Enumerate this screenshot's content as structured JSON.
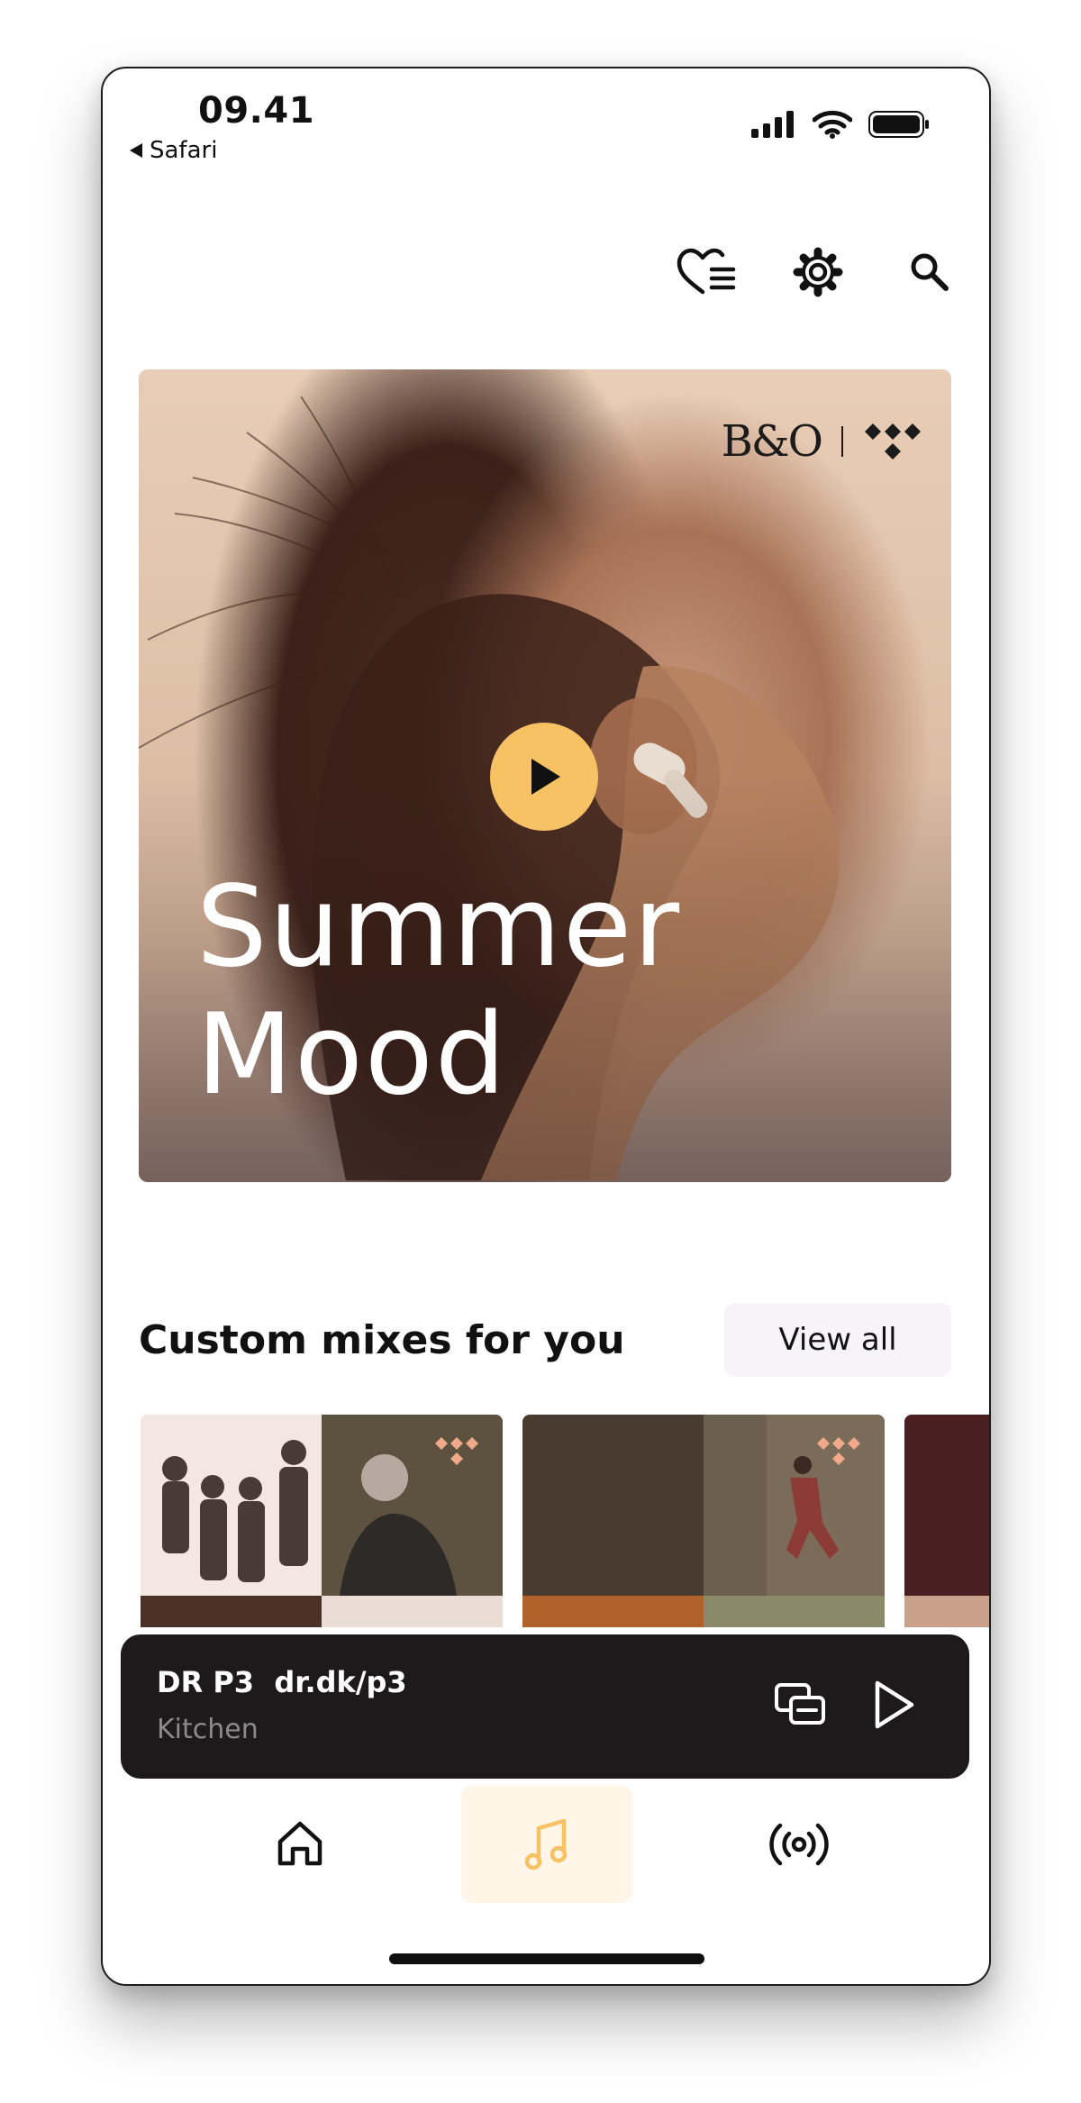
{
  "status_bar": {
    "time": "09.41",
    "back_app": "Safari"
  },
  "top_actions": {
    "icons": [
      "favorites-list-icon",
      "gear-icon",
      "search-icon"
    ]
  },
  "hero": {
    "title_line1": "Summer",
    "title_line2": "Mood",
    "brand_logo": "B&O",
    "partner_logo": "tidal-logo",
    "play_color": "#f6c263"
  },
  "custom_mixes": {
    "title": "Custom mixes for you",
    "view_all_label": "View all"
  },
  "mini_player": {
    "title": "DR P3  dr.dk/p3",
    "room": "Kitchen"
  },
  "bottom_nav": {
    "items": [
      "home-icon",
      "music-note-icon",
      "radio-broadcast-icon"
    ],
    "active": "music-note-icon",
    "accent": "#f6c263"
  }
}
